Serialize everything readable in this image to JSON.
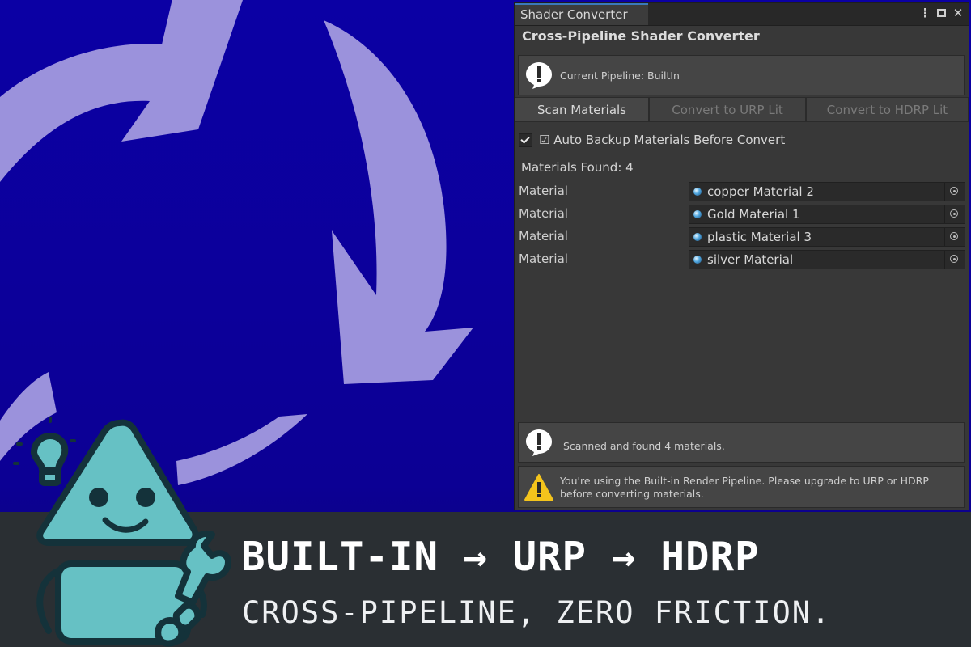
{
  "window": {
    "tab_label": "Shader Converter",
    "title": "Cross-Pipeline Shader Converter",
    "icons": [
      "more-options-icon",
      "maximize-icon",
      "close-icon"
    ],
    "close_glyph": "✕"
  },
  "pipeline_info": {
    "text": "Current Pipeline: BuiltIn",
    "icon": "info-icon"
  },
  "toolbar": {
    "scan_label": "Scan Materials",
    "urp_label": "Convert to URP Lit",
    "hdrp_label": "Convert to HDRP Lit"
  },
  "backup": {
    "label": "☑ Auto Backup Materials Before Convert",
    "checked": true
  },
  "found_label": "Materials Found: 4",
  "materials": [
    {
      "label": "Material",
      "name": "copper Material 2"
    },
    {
      "label": "Material",
      "name": "Gold Material 1"
    },
    {
      "label": "Material",
      "name": "plastic Material 3"
    },
    {
      "label": "Material",
      "name": "silver Material"
    }
  ],
  "scan_info": {
    "text": "Scanned and found 4 materials.",
    "icon": "info-icon"
  },
  "warning": {
    "text": "You're using the Built-in Render Pipeline. Please upgrade to URP or HDRP before converting materials.",
    "icon": "warning-icon"
  },
  "banner": {
    "title": "BUILT-IN → URP → HDRP",
    "subtitle": "CROSS-PIPELINE, ZERO FRICTION."
  },
  "colors": {
    "hero_blue": "#0b009e",
    "arrow_lavender": "#9b92dc",
    "mascot_teal": "#66c1c4",
    "banner_dark": "#2a2f33",
    "panel_bg": "#383838",
    "warning_yellow": "#f4c41c"
  }
}
